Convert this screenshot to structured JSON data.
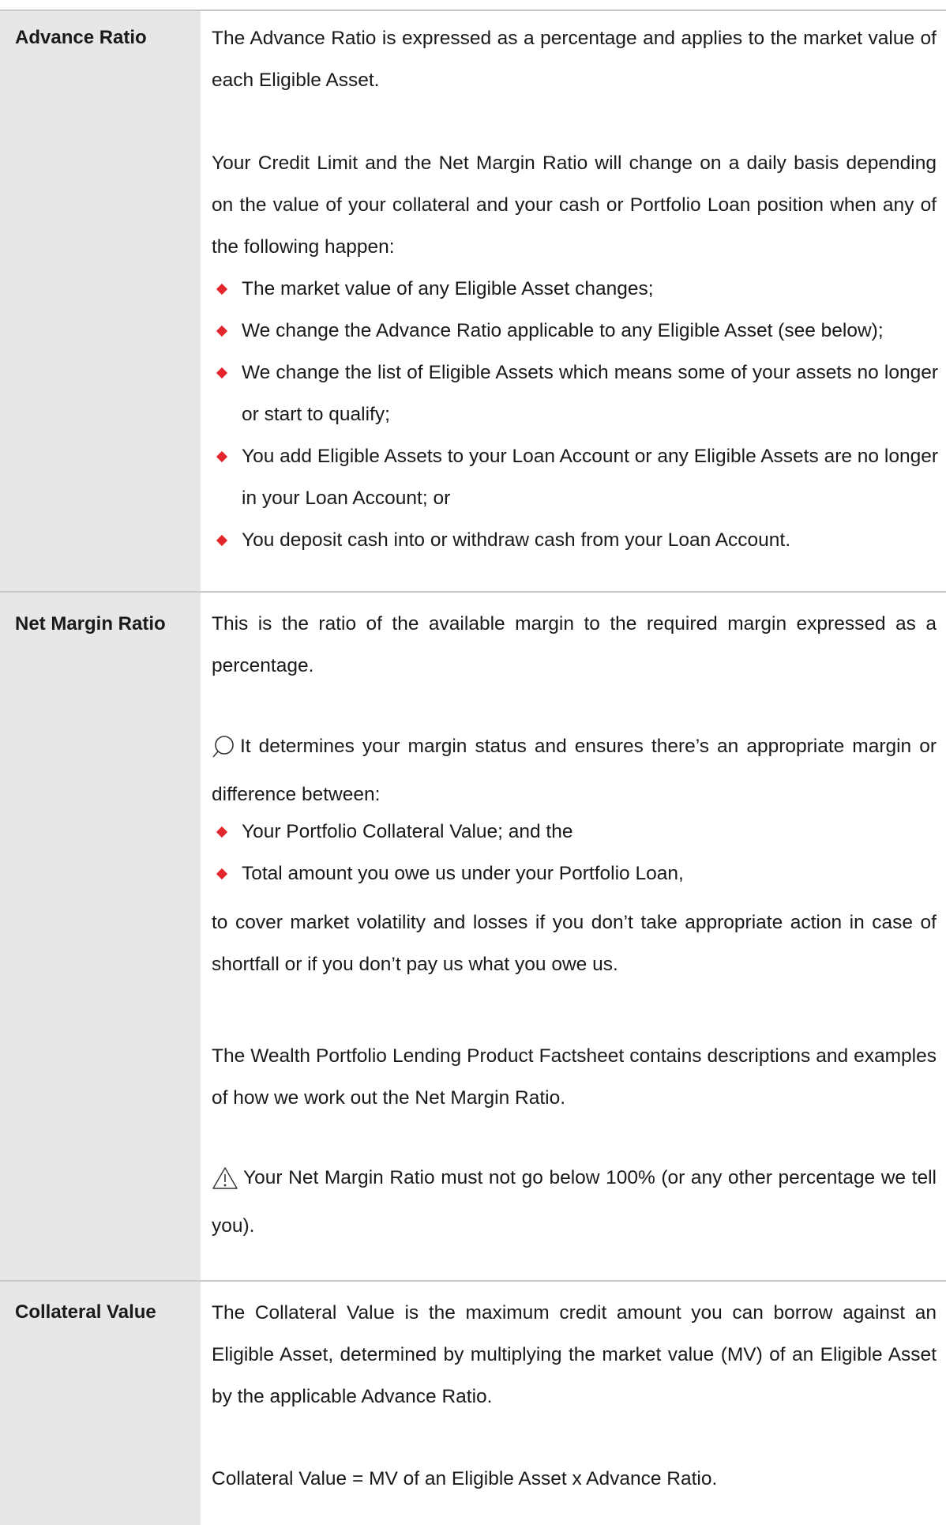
{
  "rows": [
    {
      "term": "Advance Ratio",
      "paragraphs": [
        "The Advance Ratio is expressed as a percentage and applies to the market value of each Eligible Asset.",
        "Your Credit Limit and the Net Margin Ratio will change on a daily basis depending on the value of your collateral and your cash or Portfolio Loan position when any of the following happen:"
      ],
      "bullets": [
        "The market value of any Eligible Asset changes;",
        "We change the Advance Ratio applicable to any Eligible Asset (see below);",
        "We change the list of Eligible Assets which means some of your assets no longer or start to qualify;",
        "You add Eligible Assets to your Loan Account or any Eligible Assets are no longer in your Loan Account; or",
        "You deposit cash into or withdraw cash from your Loan Account."
      ]
    },
    {
      "term": "Net Margin Ratio",
      "paragraphs": [
        "This is the ratio of the available margin to the required margin expressed as a percentage.",
        "It determines your margin status and ensures there’s an appropriate margin or difference between:",
        "to cover market volatility and losses if you don’t take appropriate action in case of shortfall or if you don’t pay us what you owe us.",
        "The Wealth Portfolio Lending Product Factsheet contains descriptions and examples of how we work out the Net Margin Ratio.",
        "Your Net Margin Ratio must not go below 100% (or any other percentage we tell you)."
      ],
      "bullets": [
        "Your Portfolio Collateral Value; and the",
        "Total amount you owe us under your Portfolio Loan,"
      ],
      "icons": [
        "magnifier-icon",
        "warning-icon"
      ]
    },
    {
      "term": "Collateral Value",
      "paragraphs": [
        "The Collateral Value is the maximum credit amount you can borrow against an Eligible Asset, determined by multiplying the market value (MV) of an Eligible Asset by the applicable Advance Ratio.",
        "Collateral Value = MV of an Eligible Asset x Advance Ratio."
      ]
    }
  ],
  "colors": {
    "label_column_bg": "#e7e7e9",
    "bullet_marker": "#e3262b",
    "divider": "#c9c9c9"
  }
}
